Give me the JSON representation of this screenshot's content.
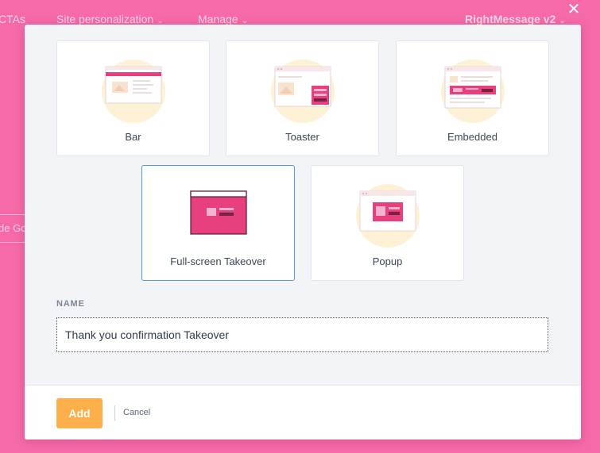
{
  "background_nav": {
    "items": [
      {
        "label": "CTAs"
      },
      {
        "label": "Site personalization"
      },
      {
        "label": "Manage"
      },
      {
        "label": "RightMessage v2"
      }
    ],
    "partial_button_text": "de Go"
  },
  "modal": {
    "close_icon": "close-icon",
    "cards": [
      {
        "label": "Bar",
        "icon": "bar-preview-icon",
        "selected": false
      },
      {
        "label": "Toaster",
        "icon": "toaster-preview-icon",
        "selected": false
      },
      {
        "label": "Embedded",
        "icon": "embedded-preview-icon",
        "selected": false
      },
      {
        "label": "Full-screen Takeover",
        "icon": "takeover-preview-icon",
        "selected": true
      },
      {
        "label": "Popup",
        "icon": "popup-preview-icon",
        "selected": false
      }
    ],
    "name_label": "NAME",
    "name_value": "Thank you confirmation Takeover",
    "add_label": "Add",
    "cancel_label": "Cancel"
  },
  "colors": {
    "page_background": "#f66aa9",
    "accent_pink": "#e8407f",
    "add_button": "#fdaf4c",
    "selected_border": "#4c9be3",
    "illustration_circle": "#fdf1d6"
  }
}
